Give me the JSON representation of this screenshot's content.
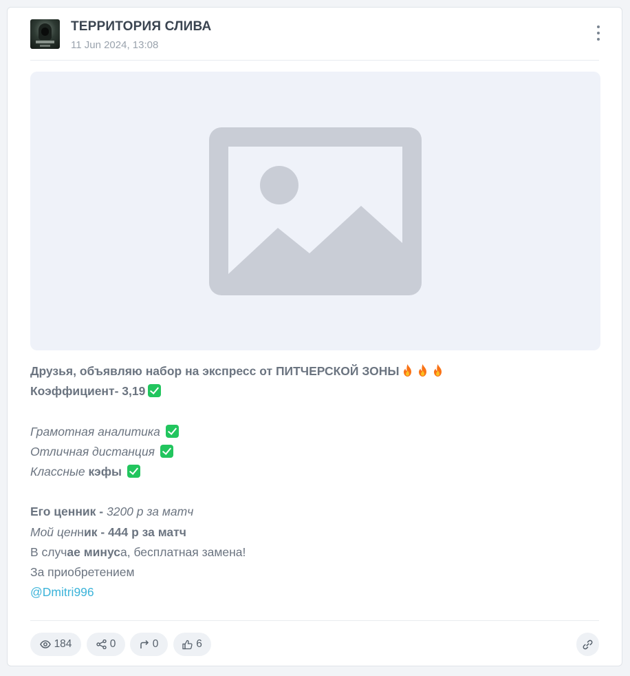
{
  "post": {
    "channel_name": "ТЕРРИТОРИЯ СЛИВА",
    "date": "11 Jun 2024, 13:08",
    "media_icon": "image-placeholder-icon",
    "text": {
      "line1": "Друзья, объявляю набор на экспресс от ПИТЧЕРСКОЙ ЗОНЫ",
      "line2": "Коэффициент- 3,19",
      "line3": "Грамотная аналитика",
      "line4": "Отличная дистанция",
      "line5_italic": "Классные",
      "line5_bold": "кэфы",
      "line6_bold": "Его ценник - ",
      "line6_italic": "3200 р за матч",
      "line7_italic": "Мой цен",
      "line7_plain": "н",
      "line7_bold": "ик - 444 р за матч",
      "line8_a": "В случ",
      "line8_b": "ае минус",
      "line8_c": "а, бесплатная замена!",
      "line9": "За приобретением",
      "mention": "@Dmitri996"
    }
  },
  "stats": {
    "views": "184",
    "shares": "0",
    "forwards": "0",
    "likes": "6"
  },
  "colors": {
    "accent_link": "#3bb3d9",
    "check_green": "#22c55e",
    "fire": "#f97316",
    "media_bg": "#eff2f9",
    "placeholder_gray": "#c9cdd6"
  }
}
